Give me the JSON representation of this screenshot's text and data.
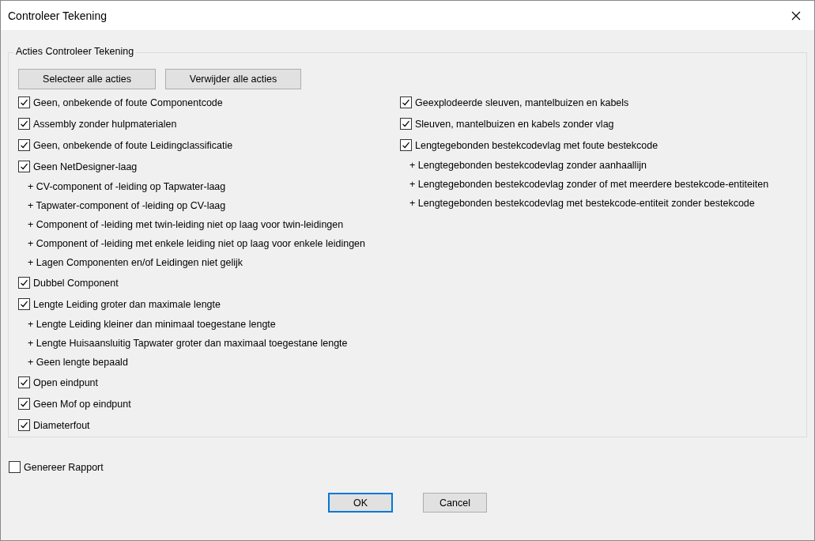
{
  "window": {
    "title": "Controleer Tekening"
  },
  "group": {
    "title": "Acties Controleer Tekening",
    "buttons": [
      "Selecteer alle acties",
      "Verwijder alle acties"
    ],
    "columns": [
      [
        {
          "kind": "check",
          "label": "Geen, onbekende of foute Componentcode",
          "checked": true
        },
        {
          "kind": "check",
          "label": "Assembly zonder hulpmaterialen",
          "checked": true
        },
        {
          "kind": "check",
          "label": "Geen, onbekende of foute Leidingclassificatie",
          "checked": true
        },
        {
          "kind": "check",
          "label": "Geen NetDesigner-laag",
          "checked": true
        },
        {
          "kind": "note",
          "label": "+ CV-component of -leiding op Tapwater-laag"
        },
        {
          "kind": "note",
          "label": "+ Tapwater-component of -leiding op CV-laag"
        },
        {
          "kind": "note",
          "label": "+ Component of -leiding met twin-leiding niet op laag voor twin-leidingen"
        },
        {
          "kind": "note",
          "label": "+ Component of -leiding met enkele leiding niet op laag voor enkele leidingen"
        },
        {
          "kind": "note",
          "label": "+ Lagen Componenten en/of Leidingen niet gelijk"
        },
        {
          "kind": "check",
          "label": "Dubbel Component",
          "checked": true
        },
        {
          "kind": "check",
          "label": "Lengte Leiding groter dan maximale lengte",
          "checked": true
        },
        {
          "kind": "note",
          "label": "+ Lengte Leiding kleiner dan minimaal toegestane lengte"
        },
        {
          "kind": "note",
          "label": "+ Lengte Huisaansluitig Tapwater groter dan maximaal toegestane lengte"
        },
        {
          "kind": "note",
          "label": "+ Geen lengte bepaald"
        },
        {
          "kind": "check",
          "label": "Open eindpunt",
          "checked": true
        },
        {
          "kind": "check",
          "label": "Geen Mof op eindpunt",
          "checked": true
        },
        {
          "kind": "check",
          "label": "Diameterfout",
          "checked": true
        }
      ],
      [
        {
          "kind": "check",
          "label": "Geexplodeerde sleuven, mantelbuizen en kabels",
          "checked": true
        },
        {
          "kind": "check",
          "label": "Sleuven, mantelbuizen en kabels zonder vlag",
          "checked": true
        },
        {
          "kind": "check",
          "label": "Lengtegebonden bestekcodevlag met foute bestekcode",
          "checked": true
        },
        {
          "kind": "note",
          "label": "+ Lengtegebonden bestekcodevlag zonder aanhaallijn"
        },
        {
          "kind": "note",
          "label": "+ Lengtegebonden bestekcodevlag zonder of met meerdere bestekcode-entiteiten"
        },
        {
          "kind": "note",
          "label": "+ Lengtegebonden bestekcodevlag met bestekcode-entiteit zonder bestekcode"
        }
      ]
    ]
  },
  "report": {
    "label": "Genereer Rapport",
    "checked": false
  },
  "footer_buttons": [
    "OK",
    "Cancel"
  ]
}
